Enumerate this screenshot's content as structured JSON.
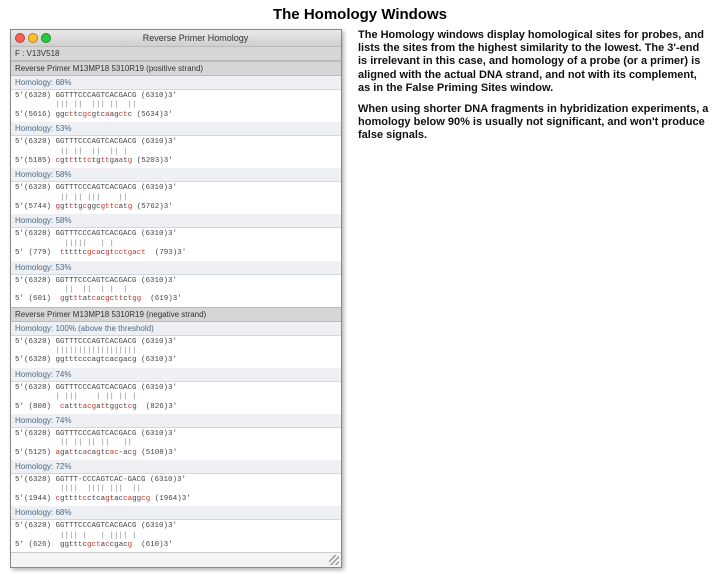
{
  "title": "The Homology Windows",
  "window": {
    "title": "Reverse Primer Homology",
    "field_label": "F : V13V518",
    "sections": [
      {
        "header": "Reverse Primer M13MP18 5310R19 (positive strand)",
        "hits": [
          {
            "label": "Homology: 68%",
            "top": "5'(6328) GGTTTCCCAGTCACGACG (6310)3'",
            "mid": "         ||| ||  ||| ||  ||",
            "bot": "5'(5616) ggcttcgcgtcaagctc (5634)3'"
          },
          {
            "label": "Homology: 53%",
            "top": "5'(6328) GGTTTCCCAGTCACGACG (6310)3'",
            "mid": "          || ||  ||  || |",
            "bot": "5'(5185) cgtttttctgttgaatg (5203)3'"
          },
          {
            "label": "Homology: 58%",
            "top": "5'(6328) GGTTTCCCAGTCACGACG (6310)3'",
            "mid": "          || || |||    ||",
            "bot": "5'(5744) ggtttgcggcgttcatg (5762)3'"
          },
          {
            "label": "Homology: 58%",
            "top": "5'(6328) GGTTTCCCAGTCACGACG (6310)3'",
            "mid": "           |||||   | |",
            "bot": "5' (779)  tttttcgcacgtcctgact  (793)3'"
          },
          {
            "label": "Homology: 53%",
            "top": "5'(6328) GGTTTCCCAGTCACGACG (6310)3'",
            "mid": "           ||  ||  | |  |",
            "bot": "5' (601)  ggtttatcacgcttctgg  (619)3'"
          }
        ]
      },
      {
        "header": "Reverse Primer M13MP18 5310R19 (negative strand)",
        "hits": [
          {
            "label": "Homology: 100% (above the threshold)",
            "top": "5'(6328) GGTTTCCCAGTCACGACG (6310)3'",
            "mid": "         ||||||||||||||||||",
            "bot": "5'(6328) ggtttcccagtcacgacg (6310)3'"
          },
          {
            "label": "Homology: 74%",
            "top": "5'(6328) GGTTTCCCAGTCACGACG (6310)3'",
            "mid": "         | |||    | || || |",
            "bot": "5' (808)  catttacgattggctcg  (826)3'"
          },
          {
            "label": "Homology: 74%",
            "top": "5'(6328) GGTTTCCCAGTCACGACG (6310)3'",
            "mid": "          || || || ||   ||",
            "bot": "5'(5125) agattcacagtcac-acg (5108)3'"
          },
          {
            "label": "Homology: 72%",
            "top": "5'(6328) GGTTT-CCCAGTCAC-GACG (6310)3'",
            "mid": "          ||||  |||| |||  ||",
            "bot": "5'(1944) cgttttcctcagtaccaggcg (1964)3'"
          },
          {
            "label": "Homology: 68%",
            "top": "5'(6328) GGTTTCCCAGTCACGACG (6310)3'",
            "mid": "          |||| |   | |||| |",
            "bot": "5' (626)  ggtttcgctaccgacg  (610)3'"
          }
        ]
      }
    ]
  },
  "right": {
    "p1": "The Homology windows display homological sites for probes, and lists the sites from the highest similarity to the lowest. The 3'-end is irrelevant in this case, and homology of a probe (or a primer) is aligned with the actual DNA strand, and not with its complement, as in the False Priming Sites window.",
    "p2": "When using shorter DNA fragments in hybridization experiments, a homology below 90% is usually not significant, and won't produce false signals."
  }
}
